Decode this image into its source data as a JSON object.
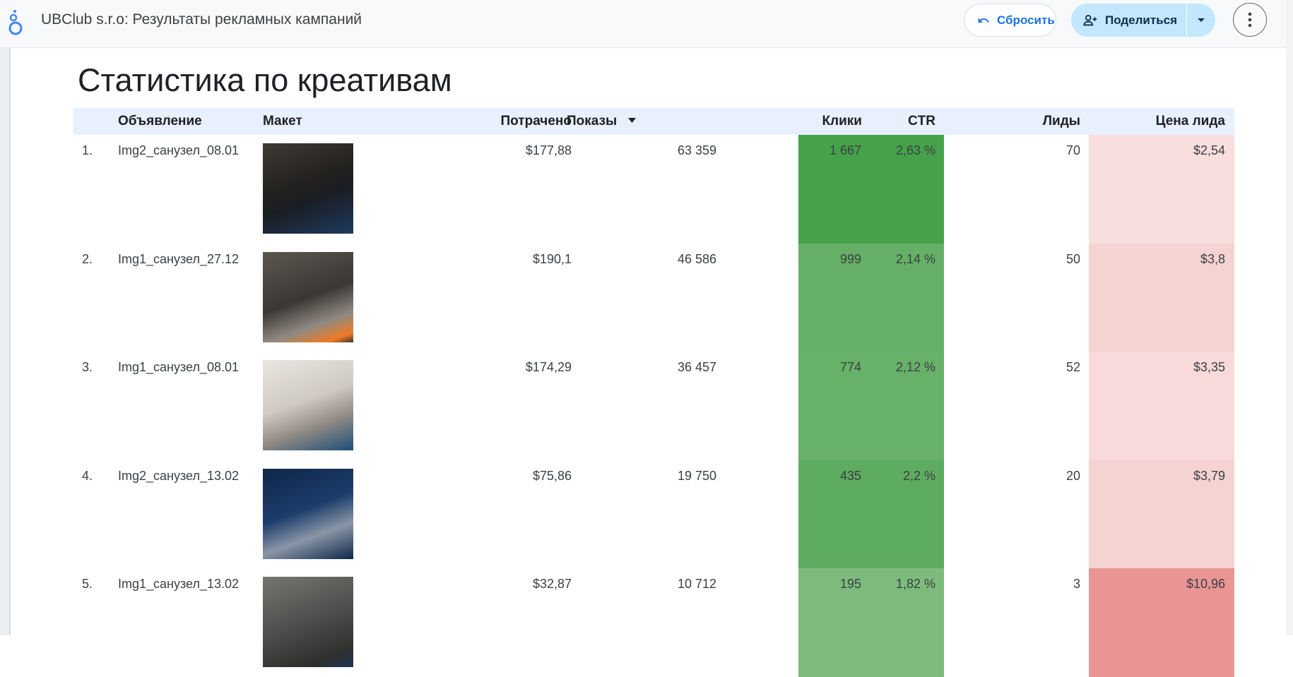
{
  "header": {
    "title": "UBClub s.r.o: Результаты рекламных кампаний",
    "reset_label": "Сбросить",
    "share_label": "Поделиться",
    "accent": "#1a73e8",
    "share_bg": "#c2e7ff"
  },
  "page": {
    "title": "Статистика по креативам"
  },
  "table": {
    "columns": [
      "Объявление",
      "Макет",
      "Потрачено",
      "Показы",
      "Клики",
      "CTR",
      "Лиды",
      "Цена лида"
    ],
    "sort_column": "Показы",
    "sort_direction": "descending",
    "rows": [
      {
        "rank": "1.",
        "ad": "Img2_санузел_08.01",
        "spent": "$177,88",
        "impressions": "63 359",
        "clicks": "1 667",
        "ctr": "2,63 %",
        "leads": "70",
        "cpl": "$2,54",
        "ctr_color": "#46a24a",
        "cpl_color": "#f8dedd"
      },
      {
        "rank": "2.",
        "ad": "Img1_санузел_27.12",
        "spent": "$190,1",
        "impressions": "46 586",
        "clicks": "999",
        "ctr": "2,14 %",
        "leads": "50",
        "cpl": "$3,8",
        "ctr_color": "#65b066",
        "cpl_color": "#f4d3d2"
      },
      {
        "rank": "3.",
        "ad": "Img1_санузел_08.01",
        "spent": "$174,29",
        "impressions": "36 457",
        "clicks": "774",
        "ctr": "2,12 %",
        "leads": "52",
        "cpl": "$3,35",
        "ctr_color": "#67b168",
        "cpl_color": "#f7dad9"
      },
      {
        "rank": "4.",
        "ad": "Img2_санузел_13.02",
        "spent": "$75,86",
        "impressions": "19 750",
        "clicks": "435",
        "ctr": "2,2 %",
        "leads": "20",
        "cpl": "$3,79",
        "ctr_color": "#5eac5f",
        "cpl_color": "#f4d3d2"
      },
      {
        "rank": "5.",
        "ad": "Img1_санузел_13.02",
        "spent": "$32,87",
        "impressions": "10 712",
        "clicks": "195",
        "ctr": "1,82 %",
        "leads": "3",
        "cpl": "$10,96",
        "ctr_color": "#7cbb7b",
        "cpl_color": "#e99593"
      }
    ]
  }
}
